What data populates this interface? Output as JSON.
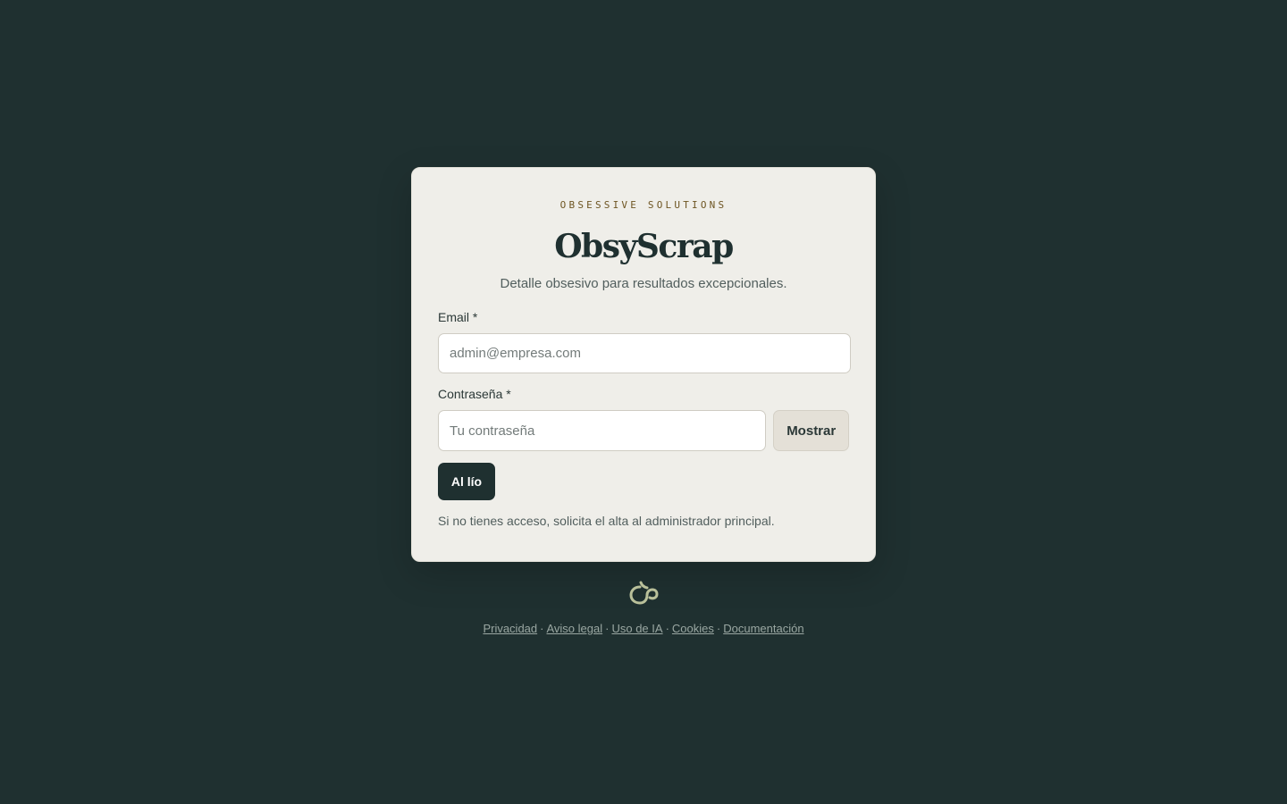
{
  "brand": {
    "eyebrow": "OBSESSIVE SOLUTIONS",
    "title": "ObsyScrap",
    "tagline": "Detalle obsesivo para resultados excepcionales."
  },
  "form": {
    "email_label": "Email *",
    "email_placeholder": "admin@empresa.com",
    "password_label": "Contraseña *",
    "password_placeholder": "Tu contraseña",
    "show_button": "Mostrar",
    "submit_button": "Al lío",
    "hint": "Si no tienes acceso, solicita el alta al administrador principal."
  },
  "logo": {
    "icon": "obsy-knot-logo-icon"
  },
  "footer": {
    "separator": "·",
    "links": [
      "Privacidad",
      "Aviso legal",
      "Uso de IA",
      "Cookies",
      "Documentación"
    ]
  },
  "colors": {
    "background": "#1f3030",
    "card": "#efeee9",
    "accent": "#6e5522",
    "logo": "#b9c09a"
  }
}
